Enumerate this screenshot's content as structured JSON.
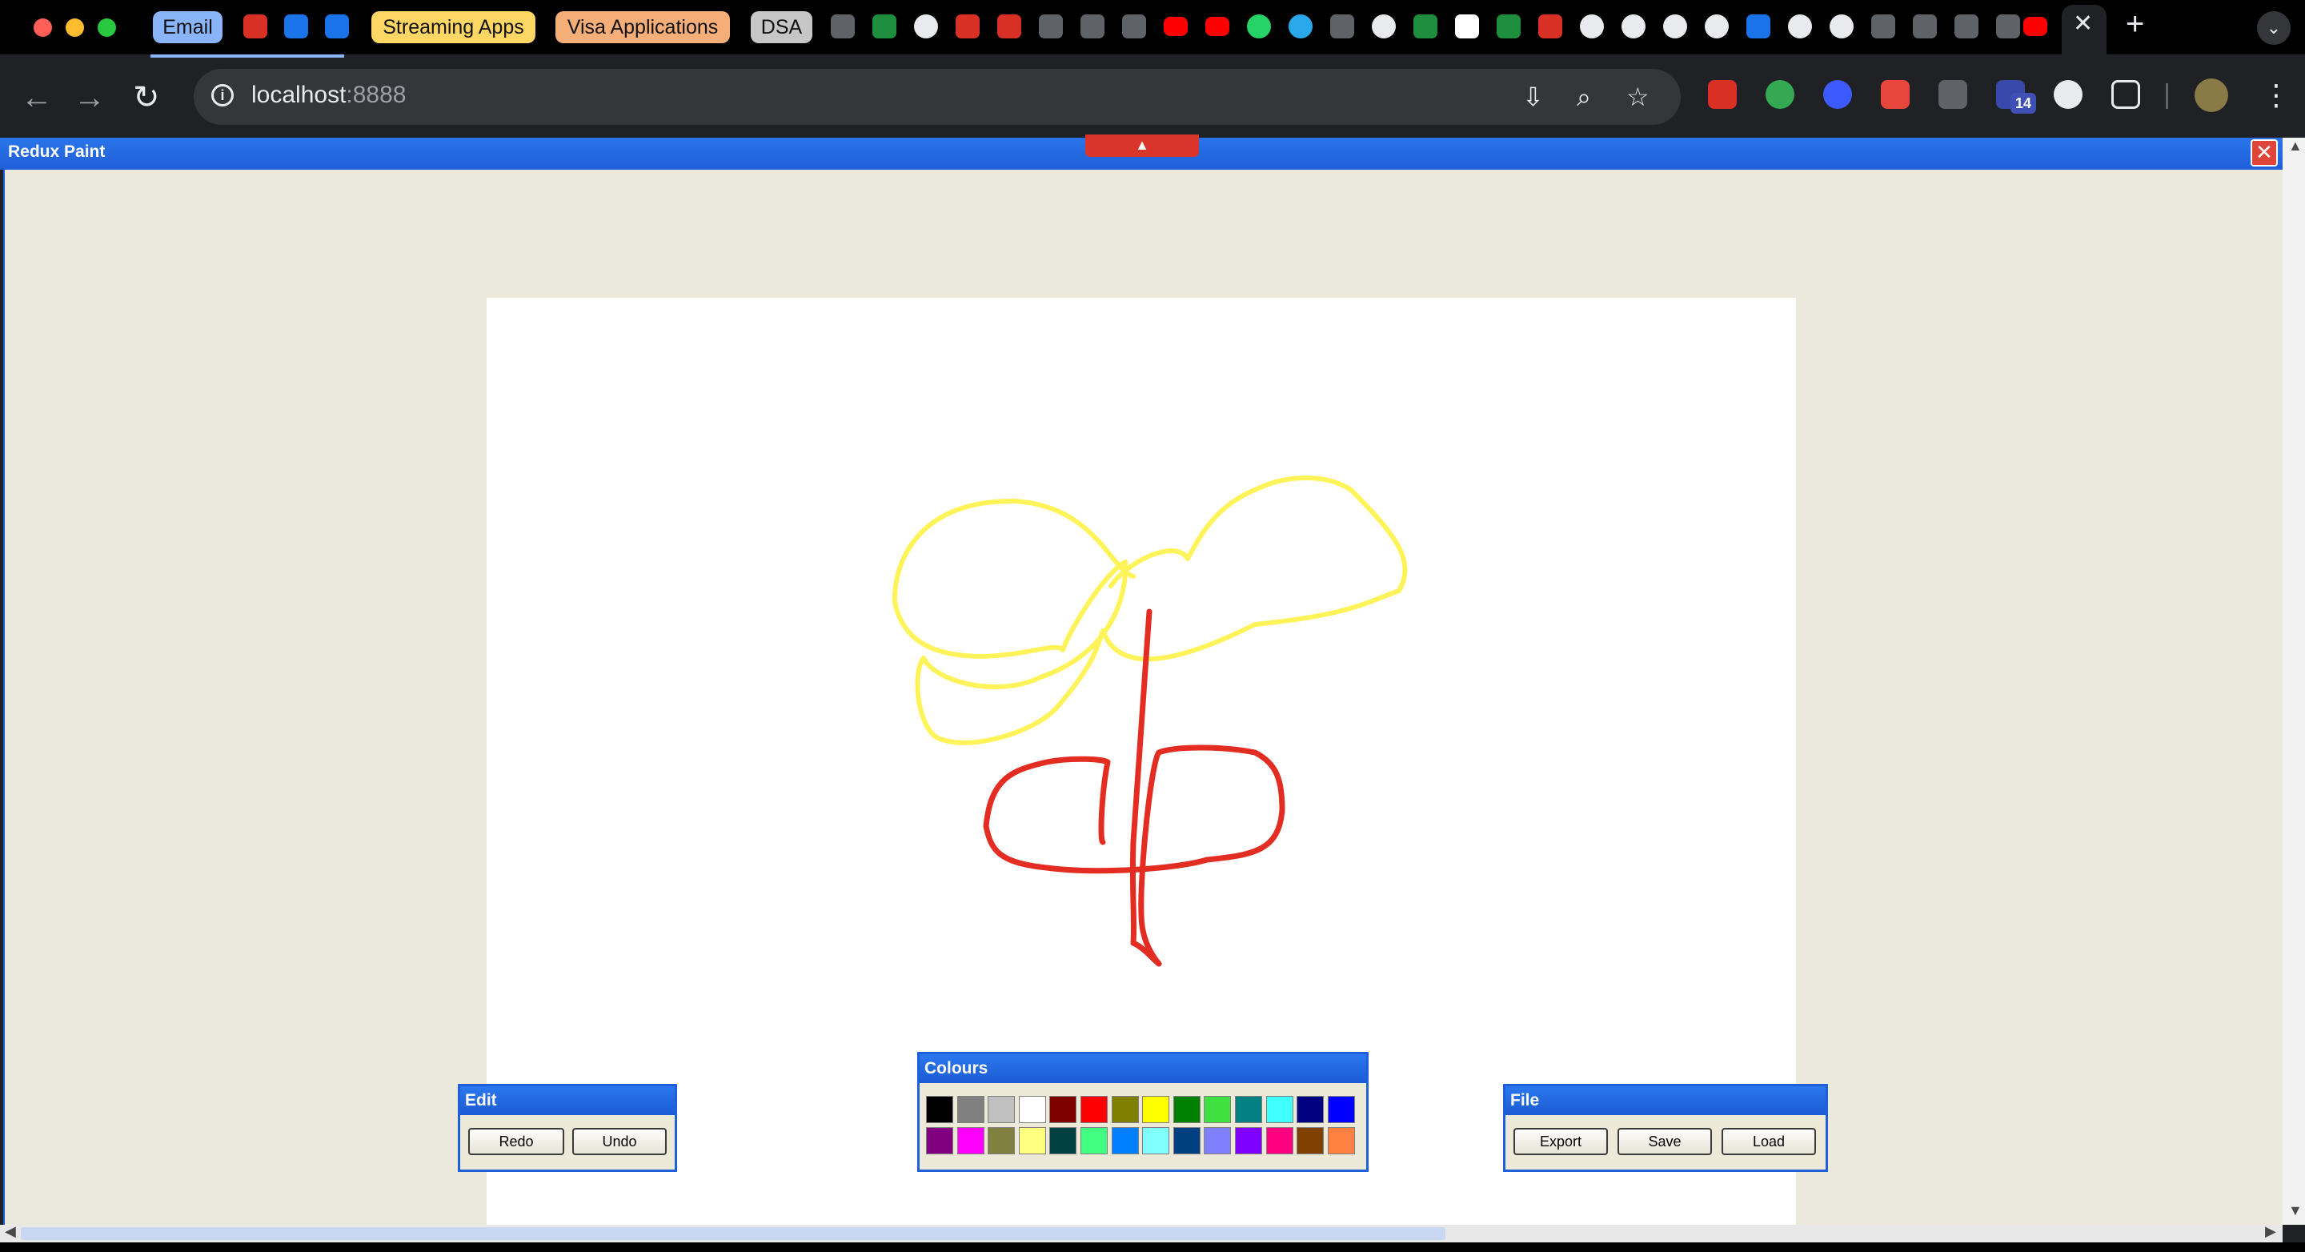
{
  "browser": {
    "tab_groups": [
      {
        "label": "Email",
        "color": "#8ab4f8"
      },
      {
        "label": "Streaming Apps",
        "color": "#fdd663"
      },
      {
        "label": "Visa Applications",
        "color": "#f6ae79"
      },
      {
        "label": "DSA",
        "color": "#c6c6c6"
      }
    ],
    "url_host": "localhost",
    "url_port": ":8888",
    "extension_badge": "14"
  },
  "app": {
    "title": "Redux Paint",
    "panels": {
      "edit": {
        "title": "Edit",
        "redo": "Redo",
        "undo": "Undo"
      },
      "colours": {
        "title": "Colours"
      },
      "file": {
        "title": "File",
        "export": "Export",
        "save": "Save",
        "load": "Load"
      }
    },
    "palette": [
      "#000000",
      "#808080",
      "#c0c0c0",
      "#ffffff",
      "#800000",
      "#ff0000",
      "#808000",
      "#ffff00",
      "#008000",
      "#40e040",
      "#008080",
      "#40ffff",
      "#000080",
      "#0000ff",
      "#800080",
      "#ff00ff",
      "#808040",
      "#ffff80",
      "#004040",
      "#40ff80",
      "#0080ff",
      "#80ffff",
      "#004080",
      "#8080ff",
      "#8000ff",
      "#ff0080",
      "#804000",
      "#ff8040"
    ],
    "stroke_colors": {
      "yellow": "#fff35a",
      "red": "#e32c22"
    }
  }
}
